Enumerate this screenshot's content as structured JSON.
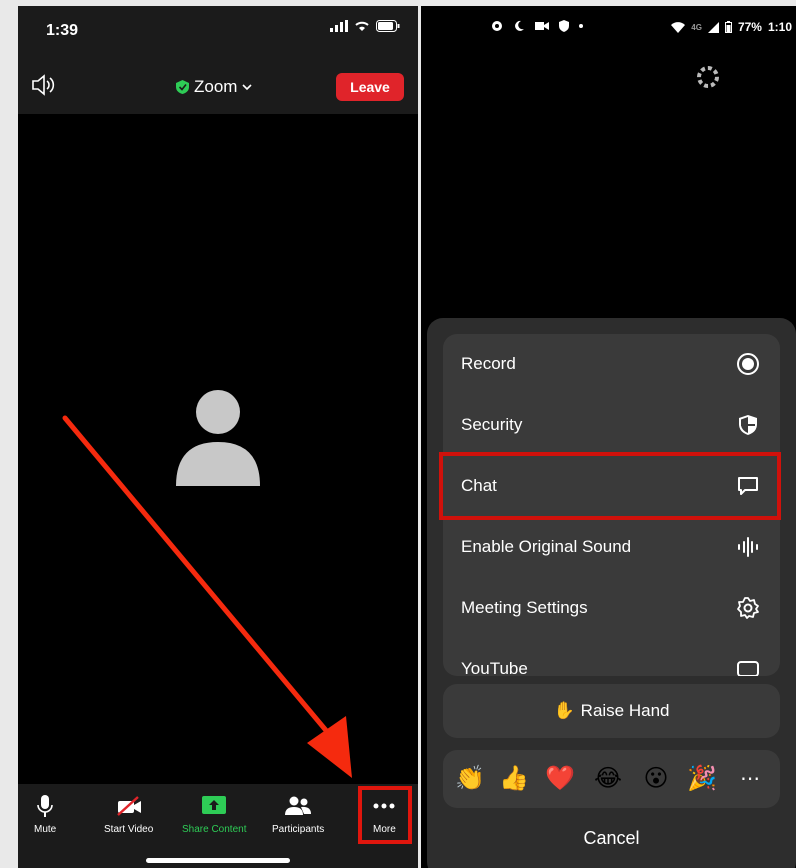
{
  "ios": {
    "time": "1:39",
    "title": "Zoom",
    "leave_label": "Leave",
    "toolbar": {
      "mute": "Mute",
      "start_video": "Start Video",
      "share_content": "Share Content",
      "participants": "Participants",
      "more": "More"
    },
    "colors": {
      "leave": "#e0242a",
      "share": "#2ecc56",
      "highlight": "#e0160d"
    }
  },
  "android": {
    "status_battery": "77%",
    "status_time": "1:10",
    "status_signal": "4G",
    "menu_items": [
      {
        "label": "Record",
        "icon": "record-icon"
      },
      {
        "label": "Security",
        "icon": "shield-icon"
      },
      {
        "label": "Chat",
        "icon": "chat-bubble-icon"
      },
      {
        "label": "Enable Original Sound",
        "icon": "audio-wave-icon"
      },
      {
        "label": "Meeting Settings",
        "icon": "gear-icon"
      },
      {
        "label": "YouTube",
        "icon": "youtube-icon"
      }
    ],
    "raise_hand": "Raise Hand",
    "raise_hand_emoji": "✋",
    "reactions": [
      "👏",
      "👍",
      "❤️",
      "😂",
      "😮",
      "🎉",
      "⋯"
    ],
    "cancel": "Cancel"
  }
}
